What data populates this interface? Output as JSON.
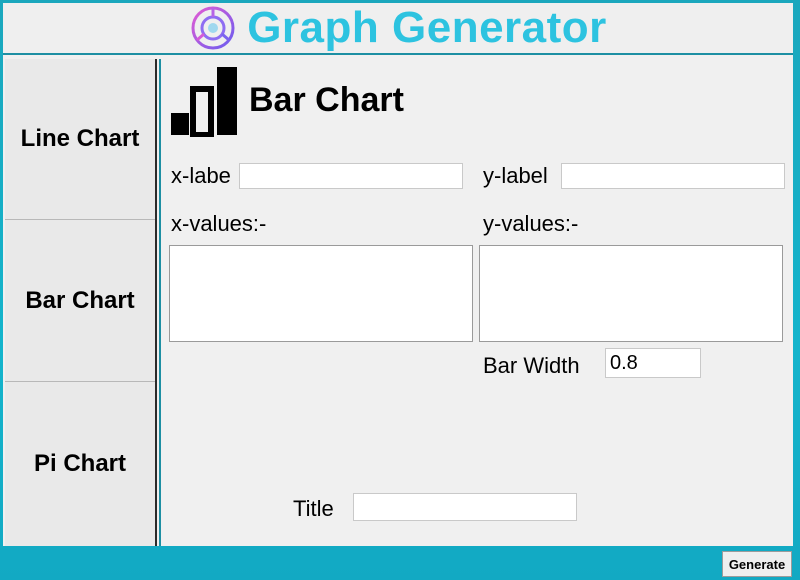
{
  "app": {
    "title": "Graph Generator"
  },
  "sidebar": {
    "items": [
      {
        "label": "Line Chart"
      },
      {
        "label": "Bar Chart"
      },
      {
        "label": "Pi Chart"
      }
    ]
  },
  "main": {
    "title": "Bar Chart",
    "x_label": {
      "label": "x-labe",
      "value": ""
    },
    "y_label": {
      "label": "y-label",
      "value": ""
    },
    "x_values": {
      "label": "x-values:-",
      "value": ""
    },
    "y_values": {
      "label": "y-values:-",
      "value": ""
    },
    "bar_width": {
      "label": "Bar Width",
      "value": "0.8"
    },
    "title_field": {
      "label": "Title",
      "value": ""
    }
  },
  "footer": {
    "generate_label": "Generate"
  },
  "colors": {
    "accent": "#2dc3e0",
    "background": "#14b4cc",
    "panel": "#f0f0f0"
  },
  "icons": {
    "logo": "pie-logo-icon",
    "chart": "bar-chart-icon"
  }
}
